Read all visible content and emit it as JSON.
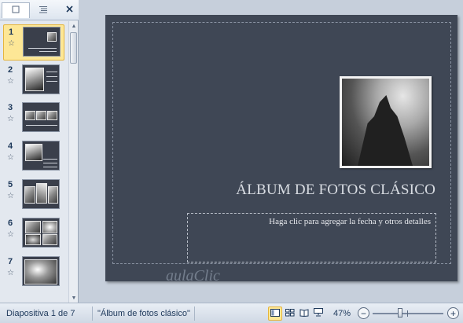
{
  "panel": {
    "tabs": [
      {
        "name": "slides-tab",
        "icon": "slides-icon",
        "selected": true
      },
      {
        "name": "outline-tab",
        "icon": "outline-icon",
        "selected": false
      }
    ],
    "close_icon": "close-icon"
  },
  "thumbnails": [
    {
      "num": "1",
      "selected": true
    },
    {
      "num": "2",
      "selected": false
    },
    {
      "num": "3",
      "selected": false
    },
    {
      "num": "4",
      "selected": false
    },
    {
      "num": "5",
      "selected": false
    },
    {
      "num": "6",
      "selected": false
    },
    {
      "num": "7",
      "selected": false
    }
  ],
  "slide": {
    "title": "ÁLBUM DE FOTOS CLÁSICO",
    "subtitle": "Haga clic para  agregar la fecha y otros detalles"
  },
  "watermark": {
    "text": "aulaClic"
  },
  "status": {
    "slide_info": "Diapositiva 1 de 7",
    "theme": "\"Álbum de fotos clásico\"",
    "zoom": "47%",
    "views": [
      "normal-view-icon",
      "slide-sorter-icon",
      "reading-view-icon",
      "slide-show-icon"
    ],
    "zoom_minus": "−",
    "zoom_plus": "+"
  },
  "colors": {
    "slide_bg": "#3f4755",
    "selected_thumb": "#fde796",
    "status_bg": "#dbe3ed"
  }
}
